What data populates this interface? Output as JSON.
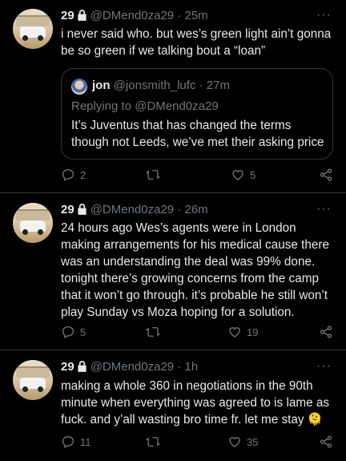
{
  "tweets": [
    {
      "name": "29",
      "handle": "@DMend0za29",
      "time": "· 25m",
      "text": "i never said who. but wes’s green light ain’t gonna be so green if we talking bout a “loan”",
      "quote": {
        "name": "jon",
        "handle": "@jonsmith_lufc",
        "time": "· 27m",
        "replying": "Replying to @DMend0za29",
        "text": "It’s Juventus that has changed the terms though not Leeds, we’ve met their asking price"
      },
      "replies": "2",
      "retweets": "",
      "likes": "5"
    },
    {
      "name": "29",
      "handle": "@DMend0za29",
      "time": "· 26m",
      "text": "24 hours ago Wes’s agents were in London making arrangements for his medical cause there was an understanding the deal was 99% done. tonight there’s growing concerns from the camp that it won’t go through. it’s probable he still won’t play Sunday vs Moza hoping for a solution.",
      "replies": "5",
      "retweets": "",
      "likes": "19"
    },
    {
      "name": "29",
      "handle": "@DMend0za29",
      "time": "· 1h",
      "text": "making a whole 360 in negotiations in the 90th minute when everything was agreed to is lame as fuck. and y’all wasting bro time fr. let me stay 🫠",
      "replies": "11",
      "retweets": "",
      "likes": "35"
    }
  ],
  "more_label": "···",
  "icons": [
    "lock-icon",
    "reply-icon",
    "retweet-icon",
    "like-icon",
    "share-icon",
    "more-icon"
  ],
  "colors": {
    "background": "#000000",
    "text": "#e7e9ea",
    "muted": "#71767b",
    "divider": "#2f3336"
  }
}
